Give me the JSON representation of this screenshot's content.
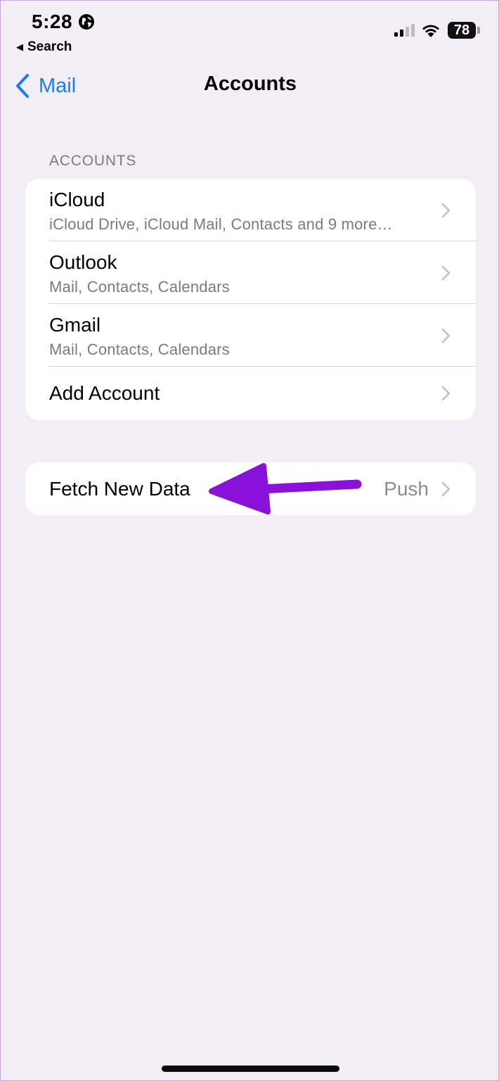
{
  "status_bar": {
    "time": "5:28",
    "back_app": "Search",
    "battery": "78"
  },
  "nav": {
    "back_label": "Mail",
    "title": "Accounts"
  },
  "accounts_section": {
    "header": "ACCOUNTS",
    "items": [
      {
        "title": "iCloud",
        "subtitle": "iCloud Drive, iCloud Mail, Contacts and 9 more…"
      },
      {
        "title": "Outlook",
        "subtitle": "Mail, Contacts, Calendars"
      },
      {
        "title": "Gmail",
        "subtitle": "Mail, Contacts, Calendars"
      },
      {
        "title": "Add Account"
      }
    ]
  },
  "fetch": {
    "title": "Fetch New Data",
    "value": "Push"
  },
  "colors": {
    "accent": "#1e7cf2",
    "annotation_arrow": "#8a12d8",
    "background": "#f1eff5"
  },
  "icons": [
    "globe-icon",
    "signal-icon",
    "wifi-icon",
    "battery-icon",
    "chevron-left-icon",
    "chevron-right-icon",
    "annotation-arrow"
  ]
}
